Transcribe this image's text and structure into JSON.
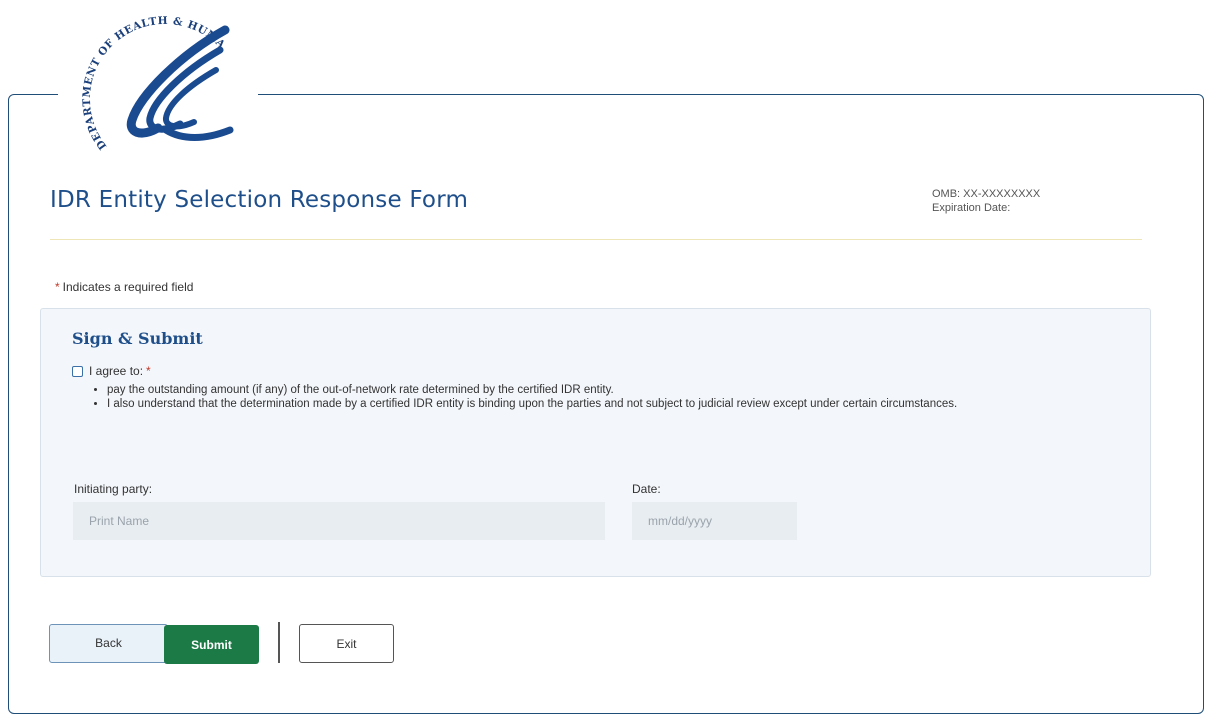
{
  "header": {
    "logo_text": "DEPARTMENT OF HEALTH & HUMAN SERVICES-USA",
    "title": "IDR Entity Selection Response Form",
    "omb": "OMB: XX-XXXXXXXX",
    "expiration": "Expiration Date:"
  },
  "required_note": {
    "star": "*",
    "text": "Indicates a required field"
  },
  "sign_submit": {
    "heading": "Sign & Submit",
    "agree_label": "I agree to:",
    "agree_star": "*",
    "agree_checked": false,
    "bullets": [
      "pay the outstanding amount (if any) of the out-of-network rate determined by the certified IDR entity.",
      "I also understand that the determination made by a certified IDR entity is binding upon the parties and not subject to judicial review except under certain circumstances."
    ],
    "initiating_party_label": "Initiating party:",
    "initiating_party_placeholder": "Print Name",
    "initiating_party_value": "",
    "date_label": "Date:",
    "date_placeholder": "mm/dd/yyyy",
    "date_value": ""
  },
  "actions": {
    "back_label": "Back",
    "submit_label": "Submit",
    "exit_label": "Exit",
    "submit_color": "#1b7a46"
  },
  "colors": {
    "primary_blue": "#1f4f8a",
    "required_red": "#c0392b"
  }
}
